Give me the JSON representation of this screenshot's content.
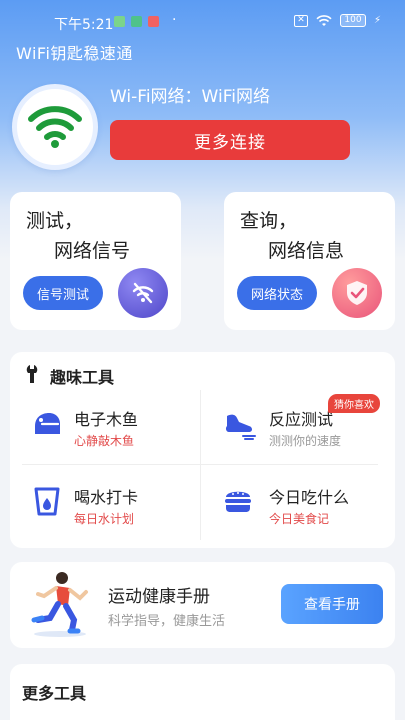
{
  "status_bar": {
    "time": "下午5:21",
    "battery": "100",
    "dot": "·"
  },
  "app": {
    "title": "WiFi钥匙稳速通"
  },
  "hero": {
    "network_label": "Wi-Fi网络：WiFi网络",
    "more_connect_button": "更多连接"
  },
  "cards": {
    "signal": {
      "line1": "测试，",
      "line2": "网络信号",
      "button": "信号测试"
    },
    "info": {
      "line1": "查询，",
      "line2": "网络信息",
      "button": "网络状态"
    }
  },
  "fun_tools": {
    "title": "趣味工具",
    "items": [
      {
        "name": "电子木鱼",
        "sub": "心静敲木鱼",
        "icon": "wooden-fish-icon"
      },
      {
        "name": "反应测试",
        "sub": "测测你的速度",
        "icon": "running-shoe-icon",
        "badge": "猜你喜欢"
      },
      {
        "name": "喝水打卡",
        "sub": "每日水计划",
        "icon": "water-cup-icon"
      },
      {
        "name": "今日吃什么",
        "sub": "今日美食记",
        "icon": "burger-icon"
      }
    ]
  },
  "health": {
    "title": "运动健康手册",
    "subtitle": "科学指导，健康生活",
    "button": "查看手册"
  },
  "more_tools": {
    "title": "更多工具"
  },
  "colors": {
    "primary_blue": "#3a6fe8",
    "accent_red": "#e83b3b",
    "wifi_green": "#1e9b3a",
    "sub_red": "#e24a4a",
    "sub_gray": "#999999"
  }
}
